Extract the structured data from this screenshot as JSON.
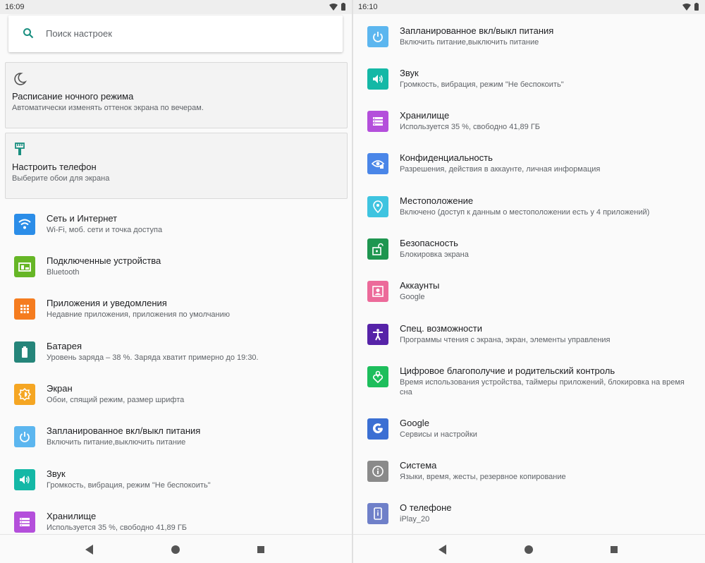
{
  "left": {
    "status_time": "16:09",
    "search_placeholder": "Поиск настроек",
    "cards": [
      {
        "title": "Расписание ночного режима",
        "subtitle": "Автоматически изменять оттенок экрана по вечерам."
      },
      {
        "title": "Настроить телефон",
        "subtitle": "Выберите обои для экрана"
      }
    ],
    "items": [
      {
        "title": "Сеть и Интернет",
        "subtitle": "Wi-Fi, моб. сети и точка доступа",
        "icon": "wifi-icon",
        "color": "#2b8de8"
      },
      {
        "title": "Подключенные устройства",
        "subtitle": "Bluetooth",
        "icon": "devices-icon",
        "color": "#66b626"
      },
      {
        "title": "Приложения и уведомления",
        "subtitle": "Недавние приложения, приложения по умолчанию",
        "icon": "apps-icon",
        "color": "#f57c1f"
      },
      {
        "title": "Батарея",
        "subtitle": "Уровень заряда – 38 %. Заряда хватит примерно до 19:30.",
        "icon": "battery-icon",
        "color": "#25857a"
      },
      {
        "title": "Экран",
        "subtitle": "Обои, спящий режим, размер шрифта",
        "icon": "brightness-icon",
        "color": "#f5a623"
      },
      {
        "title": "Запланированное вкл/выкл питания",
        "subtitle": "Включить питание,выключить питание",
        "icon": "power-icon",
        "color": "#5cb6ef"
      },
      {
        "title": "Звук",
        "subtitle": "Громкость, вибрация, режим \"Не беспокоить\"",
        "icon": "volume-icon",
        "color": "#14b8a6"
      },
      {
        "title": "Хранилище",
        "subtitle": "Используется 35 %, свободно 41,89 ГБ",
        "icon": "storage-icon",
        "color": "#b44fdb"
      }
    ]
  },
  "right": {
    "status_time": "16:10",
    "items": [
      {
        "title": "Запланированное вкл/выкл питания",
        "subtitle": "Включить питание,выключить питание",
        "icon": "power-icon",
        "color": "#5cb6ef"
      },
      {
        "title": "Звук",
        "subtitle": "Громкость, вибрация, режим \"Не беспокоить\"",
        "icon": "volume-icon",
        "color": "#14b8a6"
      },
      {
        "title": "Хранилище",
        "subtitle": "Используется 35 %, свободно 41,89 ГБ",
        "icon": "storage-icon",
        "color": "#b44fdb"
      },
      {
        "title": "Конфиденциальность",
        "subtitle": "Разрешения, действия в аккаунте, личная информация",
        "icon": "privacy-eye-icon",
        "color": "#4a86e8"
      },
      {
        "title": "Местоположение",
        "subtitle": "Включено (доступ к данным о местоположении есть у 4 приложений)",
        "icon": "location-pin-icon",
        "color": "#3ec4e0"
      },
      {
        "title": "Безопасность",
        "subtitle": "Блокировка экрана",
        "icon": "lock-icon",
        "color": "#1e9650"
      },
      {
        "title": "Аккаунты",
        "subtitle": "Google",
        "icon": "account-icon",
        "color": "#ec6a9a"
      },
      {
        "title": "Спец. возможности",
        "subtitle": "Программы чтения с экрана, экран, элементы управления",
        "icon": "accessibility-icon",
        "color": "#5623a8"
      },
      {
        "title": "Цифровое благополучие и родительский контроль",
        "subtitle": "Время использования устройства, таймеры приложений, блокировка на время сна",
        "icon": "wellbeing-icon",
        "color": "#1dbe5c"
      },
      {
        "title": "Google",
        "subtitle": "Сервисы и настройки",
        "icon": "google-icon",
        "color": "#3b6fd3"
      },
      {
        "title": "Система",
        "subtitle": "Языки, время, жесты, резервное копирование",
        "icon": "info-icon",
        "color": "#8a8a8a"
      },
      {
        "title": "О телефоне",
        "subtitle": "iPlay_20",
        "icon": "phone-icon",
        "color": "#6f80c9"
      }
    ]
  }
}
